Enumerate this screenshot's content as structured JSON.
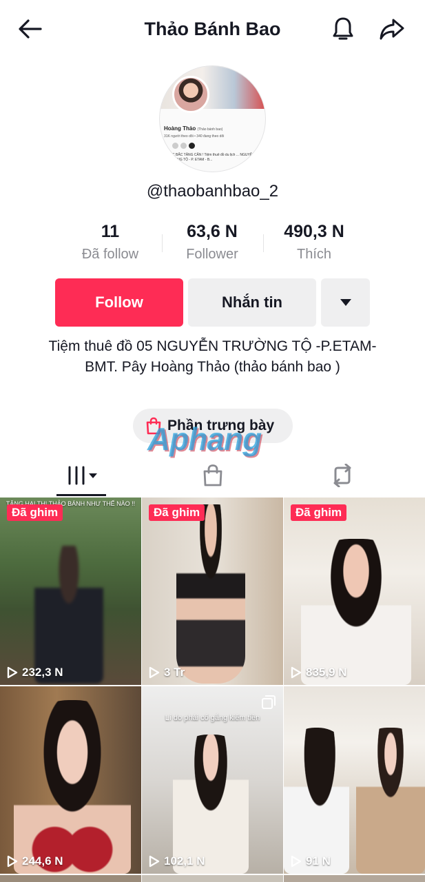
{
  "header": {
    "back_icon": "arrow-left-icon",
    "title": "Thảo Bánh Bao",
    "bell_icon": "bell-icon",
    "share_icon": "share-arrow-icon"
  },
  "avatar": {
    "name": "Hoàng Thảo",
    "name_sub": "(Thảo bánh bao)",
    "stats_text": "31K người theo dõi • 340 đang theo dõi",
    "bio_text": "...ỐC BẮC TĂNG CÂN ! Tiệm thuê đồ du lịch ... NGUYỄN TRƯỜNG TỘ - P. ETAM - B..."
  },
  "profile": {
    "handle": "@thaobanhbao_2"
  },
  "stats": [
    {
      "value": "11",
      "label": "Đã follow"
    },
    {
      "value": "63,6 N",
      "label": "Follower"
    },
    {
      "value": "490,3 N",
      "label": "Thích"
    }
  ],
  "actions": {
    "follow_label": "Follow",
    "message_label": "Nhắn tin",
    "more_icon": "caret-down-icon"
  },
  "bio": "Tiệm thuê đồ 05 NGUYỄN TRƯỜNG TỘ -P.ETAM- BMT. Pây Hoàng Thảo (thảo bánh bao )",
  "showcase": {
    "icon": "shopping-bag-icon",
    "label": "Phần trưng bày"
  },
  "watermark": "Aphang",
  "tabs": [
    {
      "name": "videos",
      "icon": "grid-bars-icon",
      "active": true
    },
    {
      "name": "shop",
      "icon": "shopping-bag-icon",
      "active": false
    },
    {
      "name": "reposts",
      "icon": "repost-icon",
      "active": false
    }
  ],
  "videos": [
    {
      "pinned": "Đã ghim",
      "views": "232,3 N",
      "caption": "TĂNG HAI THI THẢO BÁNH NHƯ THẾ NÀO !!"
    },
    {
      "pinned": "Đã ghim",
      "views": "3 Tr"
    },
    {
      "pinned": "Đã ghim",
      "views": "835,9 N"
    },
    {
      "views": "244,6 N"
    },
    {
      "views": "102,1 N",
      "caption": "Lí do phải cố gắng kiếm tiền"
    },
    {
      "views": "91 N"
    }
  ],
  "colors": {
    "accent": "#fe2c55",
    "secondary_button": "#efeff0",
    "muted_text": "#8a8b91"
  }
}
